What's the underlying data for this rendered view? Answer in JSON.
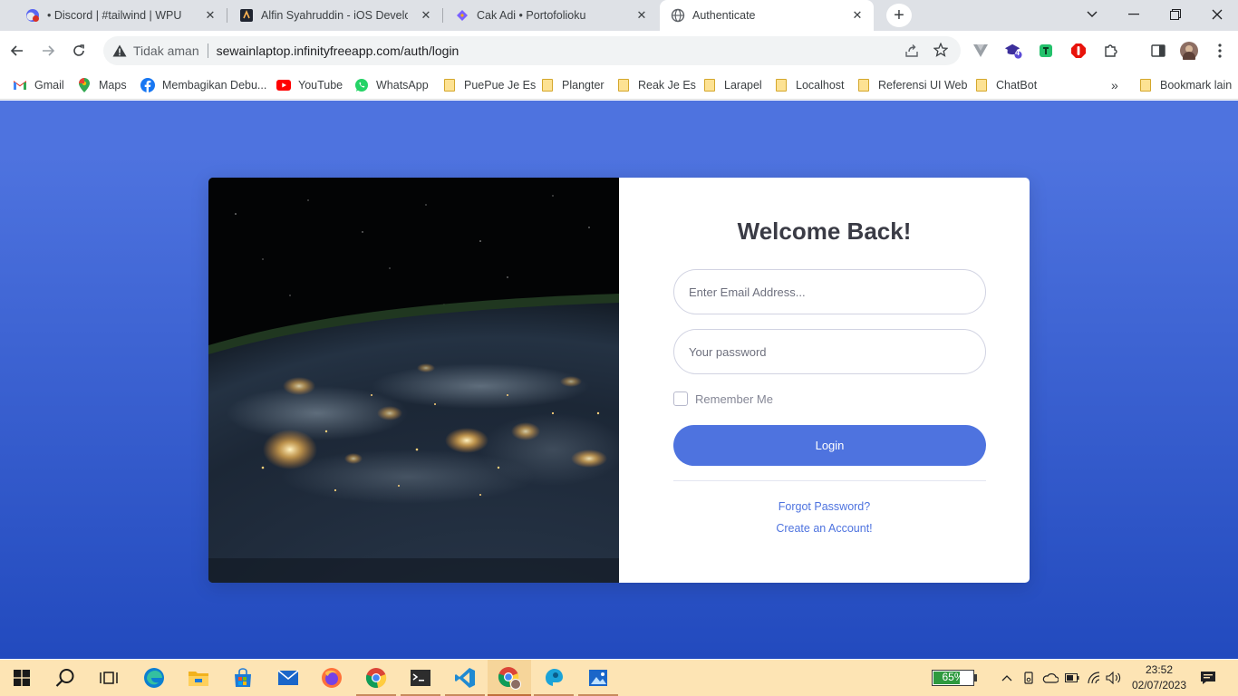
{
  "tabs": [
    {
      "title": "• Discord | #tailwind | WPU",
      "close": "✕"
    },
    {
      "title": "Alfin Syahruddin - iOS Develope",
      "close": "✕"
    },
    {
      "title": "Cak Adi • Portofolioku",
      "close": "✕"
    },
    {
      "title": "Authenticate",
      "close": "✕"
    }
  ],
  "newtab_symbol": "+",
  "address": {
    "security_label": "Tidak aman",
    "url": "sewainlaptop.infinityfreeapp.com/auth/login"
  },
  "extensions": {
    "badge_count": "4"
  },
  "bookmarks": [
    {
      "label": "Gmail",
      "icon": "gmail-icon"
    },
    {
      "label": "Maps",
      "icon": "maps-icon"
    },
    {
      "label": "Membagikan Debu...",
      "icon": "facebook-icon"
    },
    {
      "label": "YouTube",
      "icon": "youtube-icon"
    },
    {
      "label": "WhatsApp",
      "icon": "whatsapp-icon"
    },
    {
      "label": "PuePue Je Es",
      "icon": "folder-icon"
    },
    {
      "label": "Plangter",
      "icon": "folder-icon"
    },
    {
      "label": "Reak Je Es",
      "icon": "folder-icon"
    },
    {
      "label": "Larapel",
      "icon": "folder-icon"
    },
    {
      "label": "Localhost",
      "icon": "folder-icon"
    },
    {
      "label": "Referensi UI Web",
      "icon": "folder-icon"
    },
    {
      "label": "ChatBot",
      "icon": "folder-icon"
    }
  ],
  "bookmarks_overflow": "»",
  "bookmarks_other": "Bookmark lain",
  "login": {
    "heading": "Welcome Back!",
    "email_placeholder": "Enter Email Address...",
    "password_placeholder": "Your password",
    "remember_label": "Remember Me",
    "remember_checked": false,
    "submit_label": "Login",
    "forgot_link": "Forgot Password?",
    "register_link": "Create an Account!"
  },
  "colors": {
    "primary": "#4e73df",
    "gradient_end": "#224abe",
    "taskbar": "#fde4b4"
  },
  "taskbar": {
    "battery_percent": "65%",
    "time": "23:52",
    "date": "02/07/2023"
  }
}
